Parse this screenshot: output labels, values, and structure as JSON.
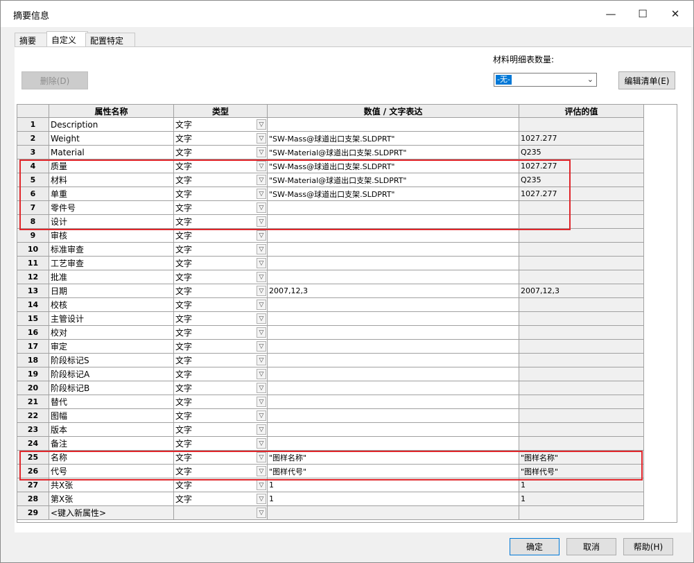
{
  "window": {
    "title": "摘要信息",
    "minimize_glyph": "—",
    "maximize_glyph": "☐",
    "close_glyph": "✕"
  },
  "tabs": [
    {
      "label": "摘要"
    },
    {
      "label": "自定义"
    },
    {
      "label": "配置特定"
    }
  ],
  "toolbar": {
    "delete_label": "删除(D)",
    "bom_qty_label": "材料明细表数量:",
    "bom_qty_value": "-无-",
    "edit_list_label": "编辑清单(E)"
  },
  "table": {
    "headers": [
      "属性名称",
      "类型",
      "数值 / 文字表达",
      "评估的值"
    ],
    "rows": [
      {
        "num": "1",
        "name": "Description",
        "type": "文字",
        "value": "",
        "evaluated": ""
      },
      {
        "num": "2",
        "name": "Weight",
        "type": "文字",
        "value": "\"SW-Mass@球道出口支架.SLDPRT\"",
        "evaluated": "1027.277"
      },
      {
        "num": "3",
        "name": "Material",
        "type": "文字",
        "value": "\"SW-Material@球道出口支架.SLDPRT\"",
        "evaluated": "Q235"
      },
      {
        "num": "4",
        "name": "质量",
        "type": "文字",
        "value": "\"SW-Mass@球道出口支架.SLDPRT\"",
        "evaluated": "1027.277"
      },
      {
        "num": "5",
        "name": "材料",
        "type": "文字",
        "value": "\"SW-Material@球道出口支架.SLDPRT\"",
        "evaluated": "Q235"
      },
      {
        "num": "6",
        "name": "单重",
        "type": "文字",
        "value": "\"SW-Mass@球道出口支架.SLDPRT\"",
        "evaluated": "1027.277"
      },
      {
        "num": "7",
        "name": "零件号",
        "type": "文字",
        "value": "",
        "evaluated": ""
      },
      {
        "num": "8",
        "name": "设计",
        "type": "文字",
        "value": "",
        "evaluated": ""
      },
      {
        "num": "9",
        "name": "审核",
        "type": "文字",
        "value": "",
        "evaluated": ""
      },
      {
        "num": "10",
        "name": "标准审查",
        "type": "文字",
        "value": "",
        "evaluated": ""
      },
      {
        "num": "11",
        "name": "工艺审查",
        "type": "文字",
        "value": "",
        "evaluated": ""
      },
      {
        "num": "12",
        "name": "批准",
        "type": "文字",
        "value": "",
        "evaluated": ""
      },
      {
        "num": "13",
        "name": "日期",
        "type": "文字",
        "value": "2007,12,3",
        "evaluated": "2007,12,3"
      },
      {
        "num": "14",
        "name": "校核",
        "type": "文字",
        "value": "",
        "evaluated": ""
      },
      {
        "num": "15",
        "name": "主管设计",
        "type": "文字",
        "value": "",
        "evaluated": ""
      },
      {
        "num": "16",
        "name": "校对",
        "type": "文字",
        "value": "",
        "evaluated": ""
      },
      {
        "num": "17",
        "name": "审定",
        "type": "文字",
        "value": "",
        "evaluated": ""
      },
      {
        "num": "18",
        "name": "阶段标记S",
        "type": "文字",
        "value": "",
        "evaluated": ""
      },
      {
        "num": "19",
        "name": "阶段标记A",
        "type": "文字",
        "value": "",
        "evaluated": ""
      },
      {
        "num": "20",
        "name": "阶段标记B",
        "type": "文字",
        "value": "",
        "evaluated": ""
      },
      {
        "num": "21",
        "name": "替代",
        "type": "文字",
        "value": "",
        "evaluated": ""
      },
      {
        "num": "22",
        "name": "图幅",
        "type": "文字",
        "value": "",
        "evaluated": ""
      },
      {
        "num": "23",
        "name": "版本",
        "type": "文字",
        "value": "",
        "evaluated": ""
      },
      {
        "num": "24",
        "name": "备注",
        "type": "文字",
        "value": "",
        "evaluated": ""
      },
      {
        "num": "25",
        "name": "名称",
        "type": "文字",
        "value": "\"图样名称\"",
        "evaluated": "\"图样名称\""
      },
      {
        "num": "26",
        "name": "代号",
        "type": "文字",
        "value": "\"图样代号\"",
        "evaluated": "\"图样代号\""
      },
      {
        "num": "27",
        "name": "共X张",
        "type": "文字",
        "value": "1",
        "evaluated": "1"
      },
      {
        "num": "28",
        "name": "第X张",
        "type": "文字",
        "value": "1",
        "evaluated": "1"
      },
      {
        "num": "29",
        "name": "<键入新属性>",
        "type": "",
        "value": "",
        "evaluated": ""
      }
    ],
    "dropdown_glyph": "▽"
  },
  "footer": {
    "ok_label": "确定",
    "cancel_label": "取消",
    "help_label": "帮助(H)"
  },
  "colors": {
    "highlight": "#e0262b",
    "accent": "#0078d7"
  }
}
